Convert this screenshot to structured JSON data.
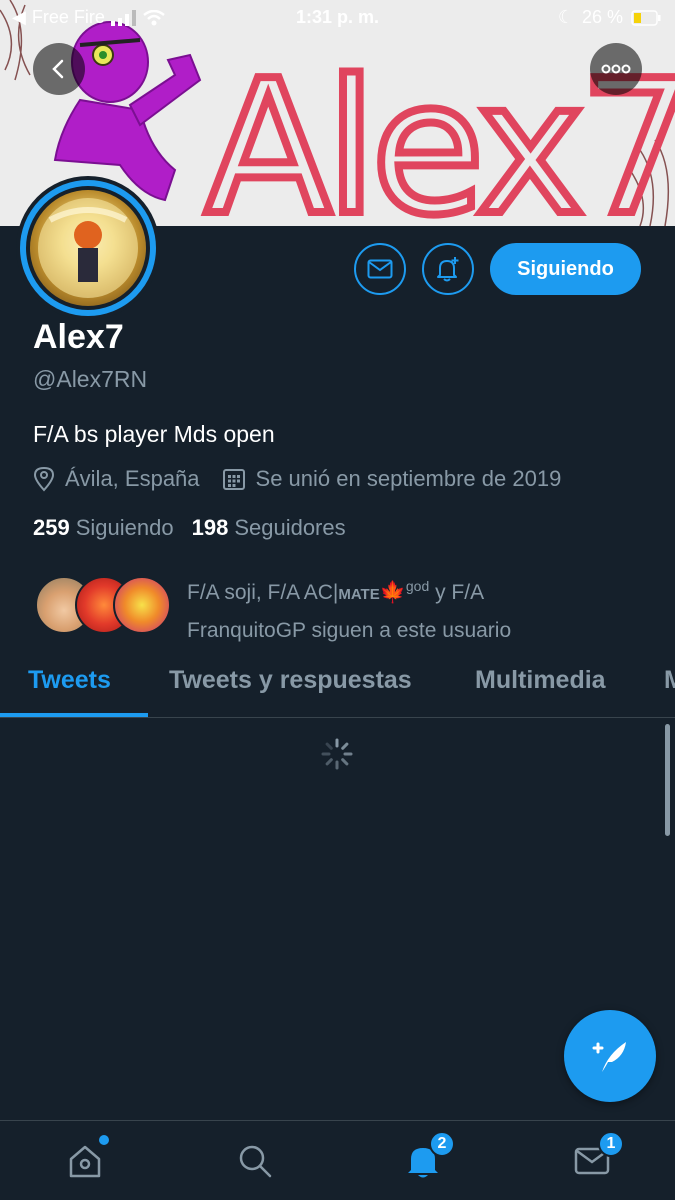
{
  "status_bar": {
    "carrier": "Free Fire",
    "time": "1:31 p. m.",
    "battery": "26 %"
  },
  "banner": {
    "text": "Alex7"
  },
  "profile": {
    "name": "Alex7",
    "handle": "@Alex7RN",
    "bio": "F/A bs player Mds open",
    "location": "Ávila, España",
    "joined": "Se unió en septiembre de 2019",
    "following_count": "259",
    "following_label": "Siguiendo",
    "followers_count": "198",
    "followers_label": "Seguidores",
    "follow_button": "Siguiendo"
  },
  "known_followers": {
    "line1_prefix": "F/A soji, F/A AC|",
    "line1_mate": "MATE",
    "line1_emoji": "🍁",
    "line1_sup": "god",
    "line1_suffix": " y F/A",
    "line2": "FranquitoGP siguen a este usuario"
  },
  "tabs": [
    {
      "label": "Tweets",
      "active": true
    },
    {
      "label": "Tweets y respuestas",
      "active": false
    },
    {
      "label": "Multimedia",
      "active": false
    },
    {
      "label": "M",
      "active": false
    }
  ],
  "bottom_nav": {
    "notifications_badge": "2",
    "messages_badge": "1"
  },
  "colors": {
    "background": "#15202b",
    "accent": "#1d9bf0",
    "secondary_text": "#8899a6",
    "banner_text": "#e0455e"
  }
}
